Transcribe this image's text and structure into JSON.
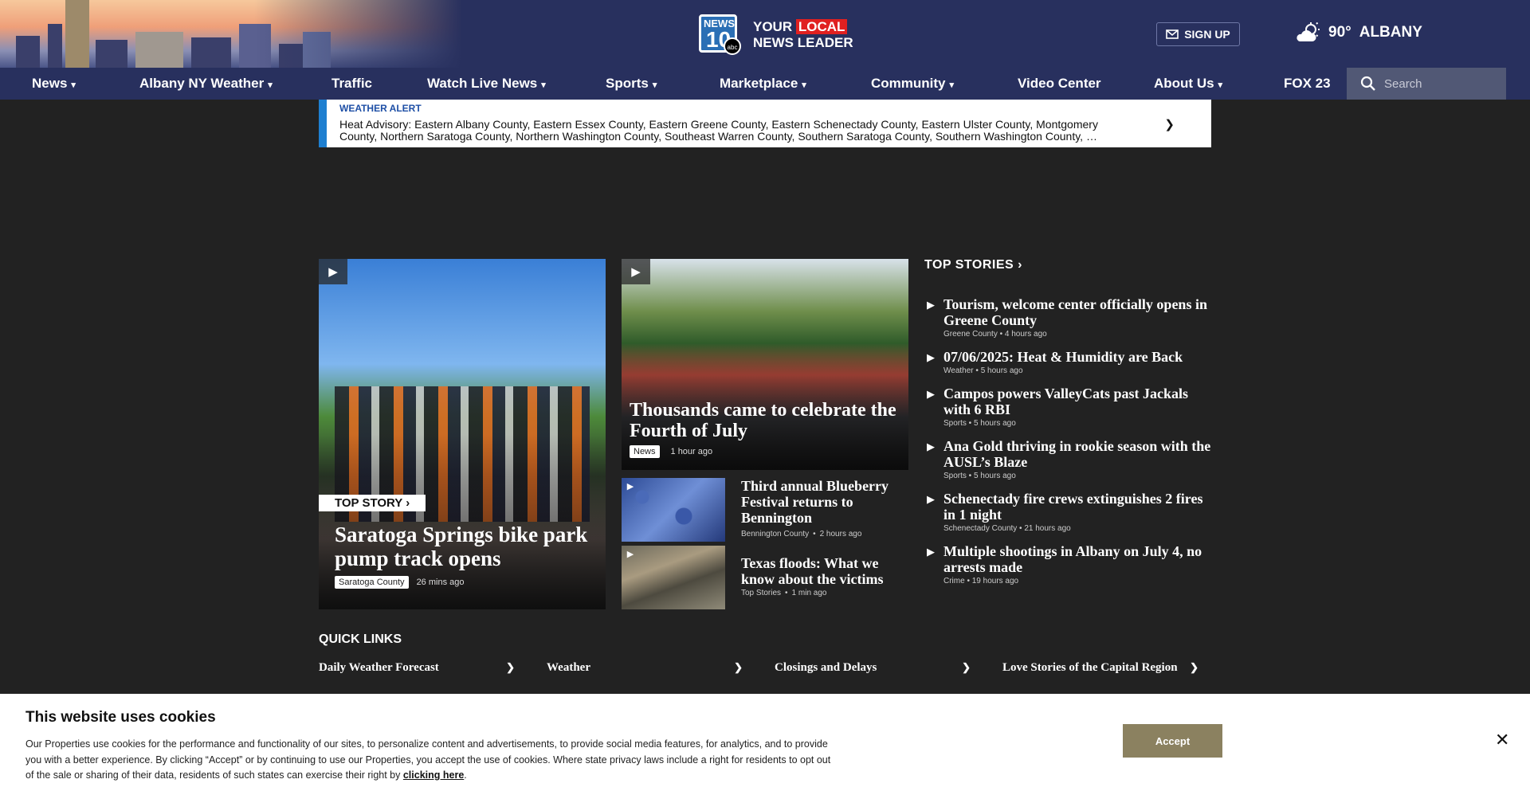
{
  "header": {
    "logo": {
      "news": "NEWS",
      "number": "10",
      "network": "abc",
      "line1_pre": "YOUR ",
      "line1_hl": "LOCAL",
      "line2": "NEWS LEADER"
    },
    "signup_label": "SIGN UP",
    "weather": {
      "temp": "90°",
      "city": "ALBANY"
    }
  },
  "nav": {
    "items": [
      {
        "label": "News"
      },
      {
        "label": "Albany NY Weather"
      },
      {
        "label": "Traffic"
      },
      {
        "label": "Watch Live News"
      },
      {
        "label": "Sports"
      },
      {
        "label": "Marketplace"
      },
      {
        "label": "Community"
      },
      {
        "label": "Video Center"
      },
      {
        "label": "About Us"
      },
      {
        "label": "FOX 23"
      }
    ],
    "search_placeholder": "Search"
  },
  "alert": {
    "label": "WEATHER ALERT",
    "message": "Heat Advisory: Eastern Albany County, Eastern Essex County, Eastern Greene County, Eastern Schenectady County, Eastern Ulster County, Montgomery County, Northern Saratoga County, Northern Washington County, Southeast Warren County, Southern Saratoga County, Southern Washington County, …"
  },
  "hero": {
    "badge": "TOP STORY",
    "title": "Saratoga Springs bike park pump track opens",
    "section": "Saratoga County",
    "time": "26 mins ago"
  },
  "secondary": {
    "title": "Thousands came to celebrate the Fourth of July",
    "section": "News",
    "time": "1 hour ago"
  },
  "small_stories": [
    {
      "title": "Third annual Blueberry Festival returns to Bennington",
      "section": "Bennington County",
      "time": "2 hours ago"
    },
    {
      "title": "Texas floods: What we know about the victims",
      "section": "Top Stories",
      "time": "1 min ago"
    }
  ],
  "top_stories": {
    "heading": "TOP STORIES",
    "items": [
      {
        "title": "Tourism, welcome center officially opens in Greene County",
        "section": "Greene County",
        "time": "4 hours ago"
      },
      {
        "title": "07/06/2025: Heat & Humidity are Back",
        "section": "Weather",
        "time": "5 hours ago"
      },
      {
        "title": "Campos powers ValleyCats past Jackals with 6 RBI",
        "section": "Sports",
        "time": "5 hours ago"
      },
      {
        "title": "Ana Gold thriving in rookie season with the AUSL’s Blaze",
        "section": "Sports",
        "time": "5 hours ago"
      },
      {
        "title": "Schenectady fire crews extinguishes 2 fires in 1 night",
        "section": "Schenectady County",
        "time": "21 hours ago"
      },
      {
        "title": "Multiple shootings in Albany on July 4, no arrests made",
        "section": "Crime",
        "time": "19 hours ago"
      }
    ]
  },
  "quick_links": {
    "heading": "QUICK LINKS",
    "items": [
      {
        "label": "Daily Weather Forecast"
      },
      {
        "label": "Weather"
      },
      {
        "label": "Closings and Delays"
      },
      {
        "label": "Love Stories of the Capital Region"
      }
    ]
  },
  "cookie": {
    "title": "This website uses cookies",
    "text": "Our Properties use cookies for the performance and functionality of our sites, to personalize content and advertisements, to provide social media features, for analytics, and to provide you with a better experience. By clicking “Accept” or by continuing to use our Properties, you accept the use of cookies. Where state privacy laws include a right for residents to opt out of the sale or sharing of their data, residents of such states can exercise their right by ",
    "link": "clicking here",
    "end": ".",
    "accept_label": "Accept"
  },
  "colors": {
    "header": "#28305e",
    "page": "#222222",
    "alert_accent": "#1e7fd0",
    "accept": "#8b8160"
  }
}
